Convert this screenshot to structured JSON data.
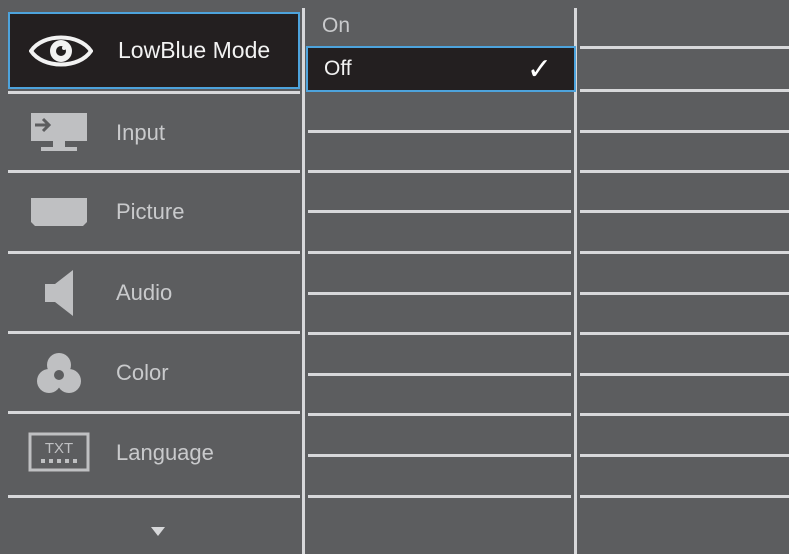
{
  "menu": {
    "items": [
      {
        "label": "LowBlue Mode",
        "icon": "eye-icon",
        "selected": true
      },
      {
        "label": "Input",
        "icon": "input-monitor-icon"
      },
      {
        "label": "Picture",
        "icon": "picture-screen-icon"
      },
      {
        "label": "Audio",
        "icon": "speaker-icon"
      },
      {
        "label": "Color",
        "icon": "color-circles-icon"
      },
      {
        "label": "Language",
        "icon": "txt-language-icon"
      }
    ],
    "more_icon": "chevron-down-icon"
  },
  "submenu": {
    "options": [
      {
        "label": "On",
        "selected": false
      },
      {
        "label": "Off",
        "selected": true,
        "check": "✓"
      }
    ]
  },
  "language_icon_text": "TXT",
  "colors": {
    "panel": "#5c5d5f",
    "selected_bg": "#231f20",
    "highlight_border": "#4da3dc",
    "separator": "#d7d8da"
  }
}
